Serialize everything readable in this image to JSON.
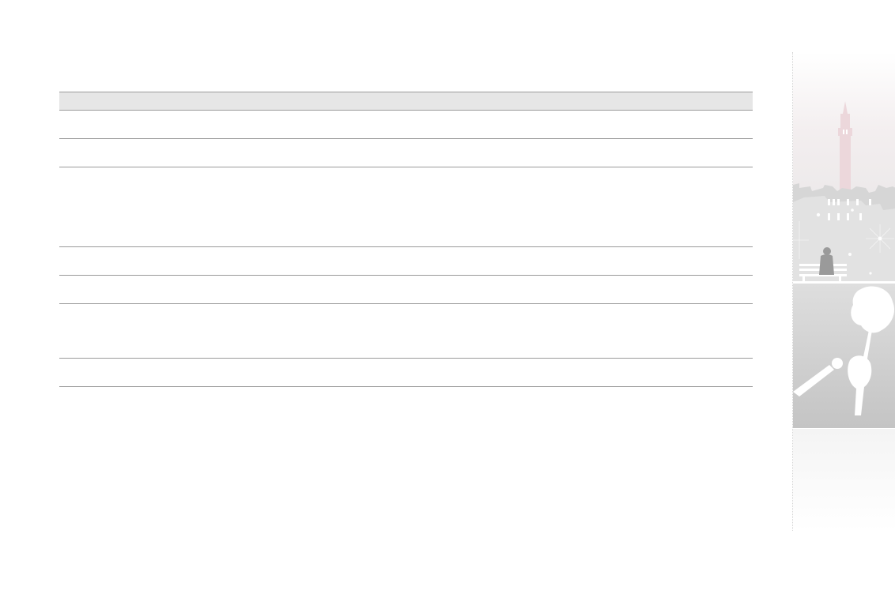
{
  "table": {
    "header": "",
    "rows": [
      "",
      "",
      "",
      "",
      "",
      "",
      ""
    ]
  },
  "side_illustration": {
    "icon": "city-park-illustration",
    "colors": {
      "sky": "#f3eeef",
      "tower": "#ecd7db",
      "buildings": "#dcdcdc",
      "ground": "#c6c6c6",
      "divider": "#ffffff"
    }
  }
}
